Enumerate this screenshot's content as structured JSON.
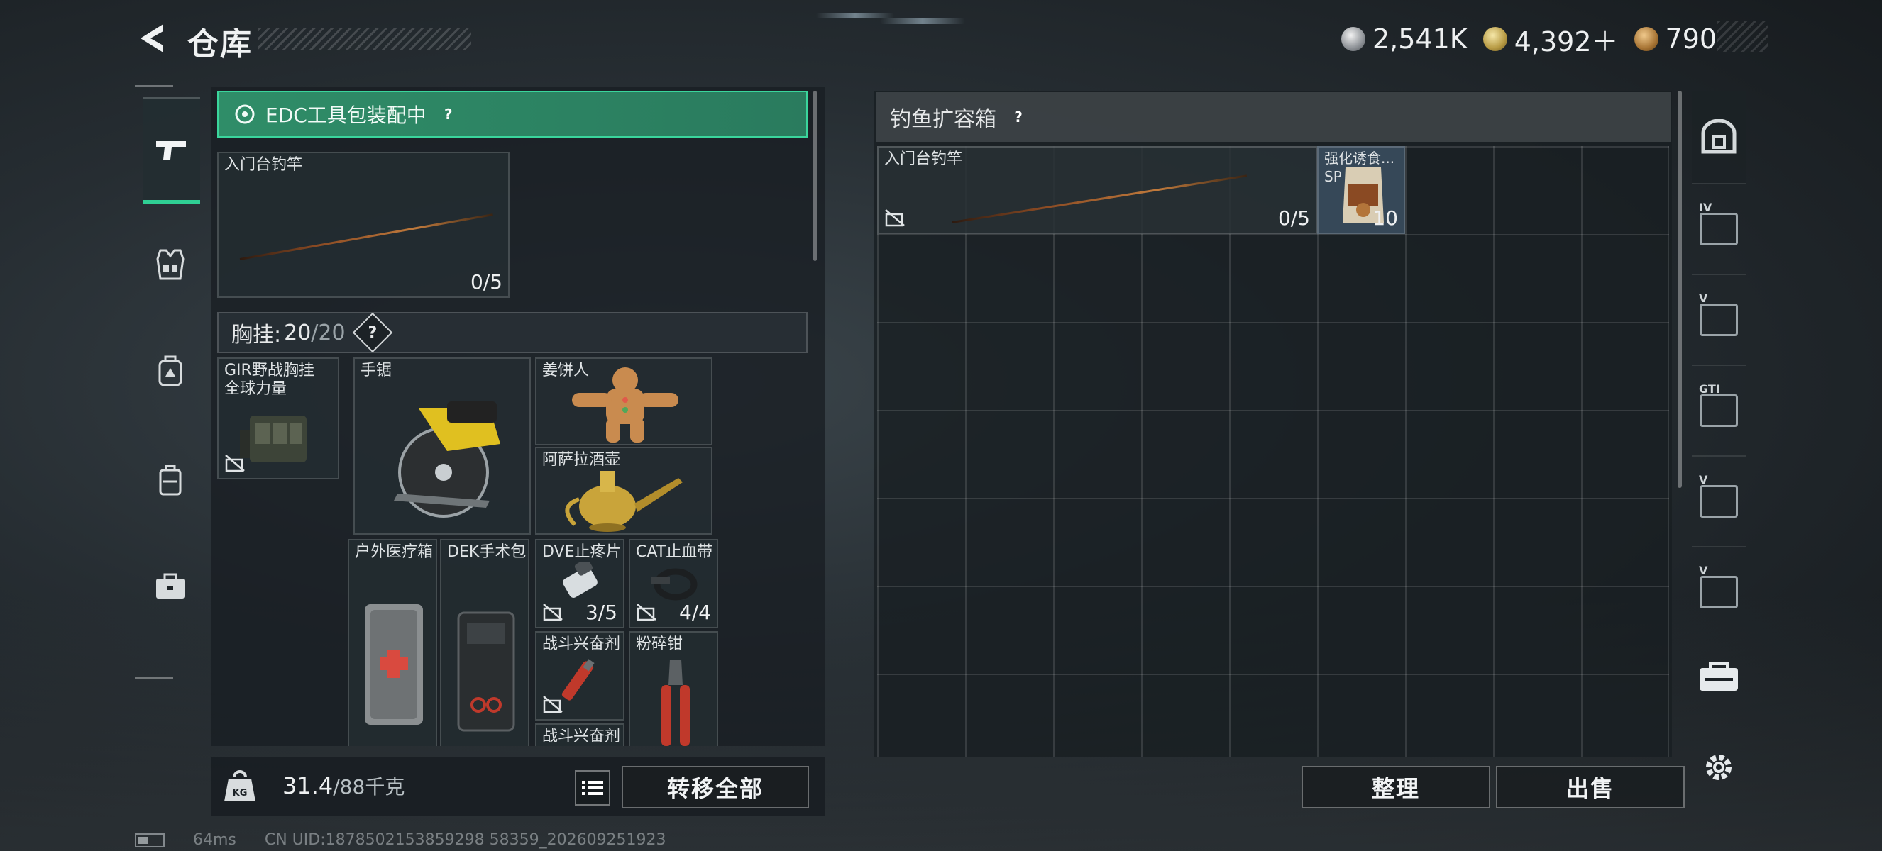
{
  "header": {
    "title": "仓库",
    "currencies": [
      {
        "icon": "silver-coin-icon",
        "value": "2,541K"
      },
      {
        "icon": "gold-coin-icon",
        "value": "4,392＋"
      },
      {
        "icon": "bronze-coin-icon",
        "value": "790"
      }
    ]
  },
  "left_rail": {
    "items": [
      {
        "icon": "pistol-icon",
        "active": true
      },
      {
        "icon": "vest-icon",
        "active": false
      },
      {
        "icon": "backpack-icon",
        "active": false
      },
      {
        "icon": "case-icon",
        "active": false
      },
      {
        "icon": "toolbox-icon",
        "active": false
      }
    ]
  },
  "loadout": {
    "edc_title": "EDC工具包装配中",
    "help": "?",
    "rod": {
      "label": "入门台钓竿",
      "count": "0/5"
    },
    "chest_rig": {
      "label": "胸挂:",
      "current": "20",
      "max": "/20",
      "help": "?"
    },
    "items": [
      {
        "label": "GIR野战胸挂\n全球力量",
        "icon": "chest-rig-icon"
      },
      {
        "label": "手锯",
        "icon": "circular-saw-icon"
      },
      {
        "label": "姜饼人",
        "icon": "gingerbread-icon"
      },
      {
        "label": "阿萨拉酒壶",
        "icon": "wine-ewer-icon"
      },
      {
        "label": "户外医疗箱",
        "icon": "medical-kit-icon"
      },
      {
        "label": "DEK手术包",
        "icon": "surgery-kit-icon"
      },
      {
        "label": "DVE止疼片",
        "icon": "painkiller-icon",
        "count": "3/5"
      },
      {
        "label": "CAT止血带",
        "icon": "tourniquet-icon",
        "count": "4/4"
      },
      {
        "label": "战斗兴奋剂",
        "icon": "stimulant-icon"
      },
      {
        "label": "粉碎钳",
        "icon": "pliers-icon"
      },
      {
        "label": "战斗兴奋剂",
        "icon": "stimulant-icon"
      }
    ]
  },
  "weight": {
    "current": "31.4",
    "max": "/88千克"
  },
  "buttons": {
    "transfer_all": "转移全部",
    "sort": "整理",
    "sell": "出售"
  },
  "container": {
    "title": "钓鱼扩容箱",
    "help": "?",
    "items": [
      {
        "label": "入门台钓竿",
        "count": "0/5",
        "icon": "fishing-rod-icon"
      },
      {
        "label": "强化诱食...",
        "sublabel": "SP",
        "count": "10",
        "icon": "bait-bag-icon"
      }
    ]
  },
  "case_rail": {
    "items": [
      {
        "badge": "IV"
      },
      {
        "badge": "V"
      },
      {
        "badge": "GTI"
      },
      {
        "badge": "V"
      },
      {
        "badge": "V"
      }
    ]
  },
  "status": {
    "ping": "64ms",
    "uid": "CN UID:1878502153859298 58359_202609251923"
  }
}
